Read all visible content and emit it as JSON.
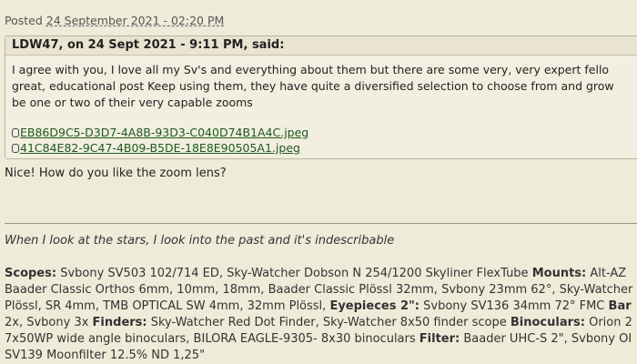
{
  "post": {
    "posted_prefix": "Posted",
    "posted_date": "24 September 2021 - 02:20 PM"
  },
  "quote": {
    "header": "LDW47, on 24 Sept 2021 - 9:11 PM, said:",
    "lines": [
      "I agree with you, I love all my Sv's and everything about them but there are some very, very expert fello",
      "great, educational post  Keep using them, they have quite a diversified selection to choose from and grow",
      "be one or two of their very capable zooms"
    ],
    "attachments": [
      "EB86D9C5-D3D7-4A8B-93D3-C040D74B1A4C.jpeg",
      "41C84E82-9C47-4B09-B5DE-18E8E90505A1.jpeg"
    ]
  },
  "reply": {
    "text": "Nice! How do you like the zoom lens?"
  },
  "signature": {
    "quote": "When I look at the stars, I look into the past and it's indescribable",
    "scopes_label": "Scopes:",
    "scopes_text": " Svbony SV503 102/714 ED, Sky-Watcher Dobson N 254/1200 Skyliner FlexTube ",
    "mounts_label": "Mounts:",
    "mounts_text": " Alt-AZ",
    "line2": "Baader Classic Orthos 6mm, 10mm, 18mm, Baader Classic Plössl 32mm, Svbony 23mm 62°, Sky-Watcher",
    "line3_text": "Plössl, SR 4mm, TMB OPTICAL SW 4mm, 32mm Plössl, ",
    "eyepieces2_label": "Eyepieces 2\":",
    "line3_text2": " Svbony SV136 34mm 72° FMC ",
    "line3_label_cut": "Bar",
    "line4_text": "2x, Svbony 3x ",
    "finders_label": "Finders:",
    "line4_text2": " Sky-Watcher Red Dot Finder, Sky-Watcher 8x50 finder scope ",
    "binoculars_label": "Binoculars:",
    "line4_text3": " Orion 2",
    "line5_text": "7x50WP wide angle binoculars, BILORA EAGLE-9305- 8x30 binoculars ",
    "filter_label": "Filter:",
    "line5_text2": " Baader UHC-S 2\", Svbony OI",
    "line6": "SV139 Moonfilter 12.5% ND 1,25\""
  }
}
